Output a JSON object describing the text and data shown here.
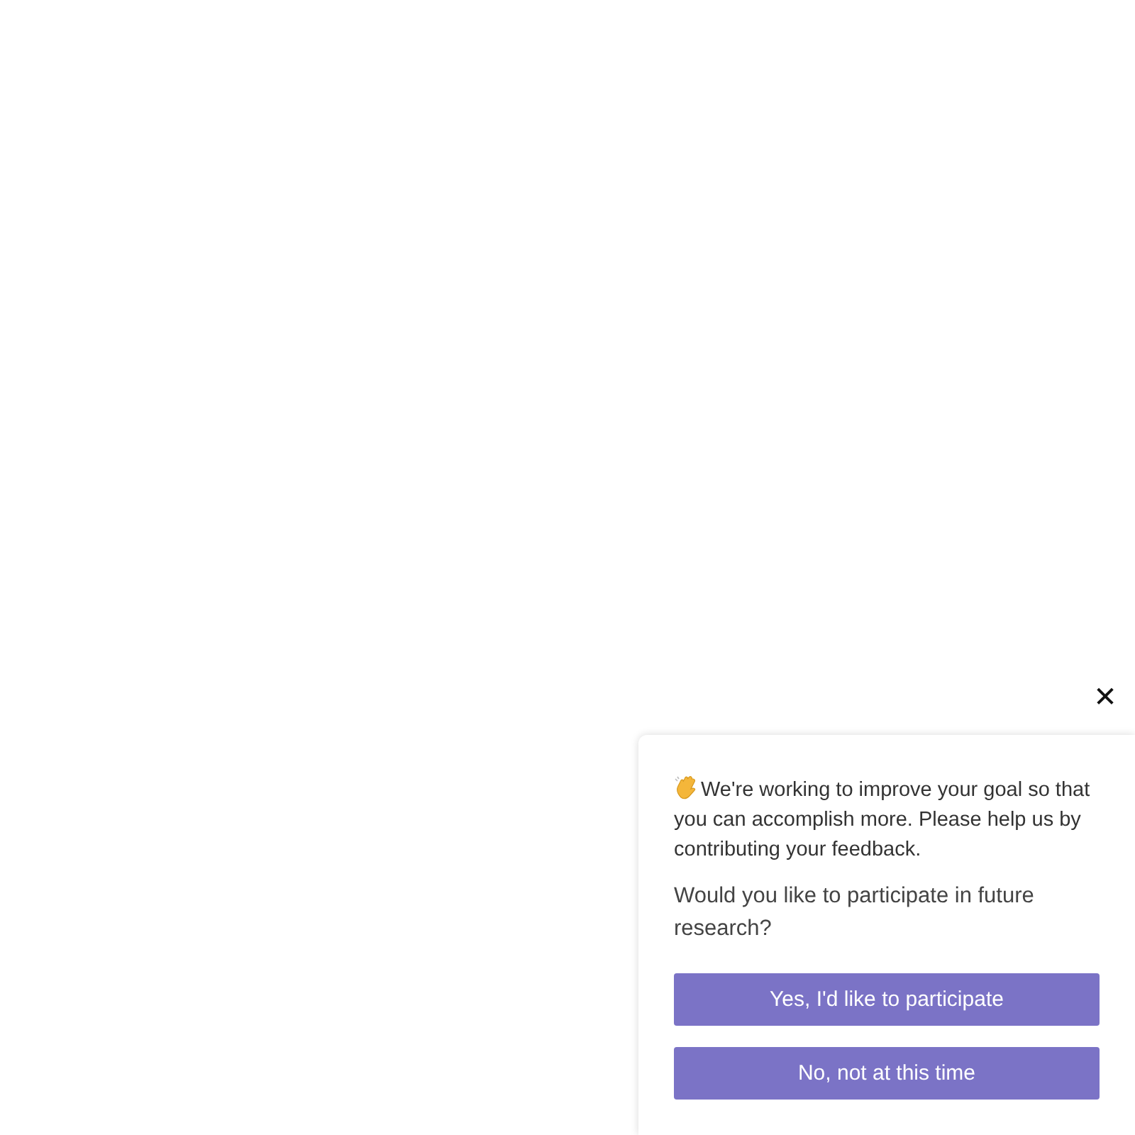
{
  "popup": {
    "close_label": "✕",
    "intro": "We're working to improve your goal so that you can accomplish more. Please help us by contributing your feedback.",
    "question": "Would you like to participate in future research?",
    "buttons": [
      "Yes, I'd like to participate",
      "No, not at this time"
    ]
  }
}
